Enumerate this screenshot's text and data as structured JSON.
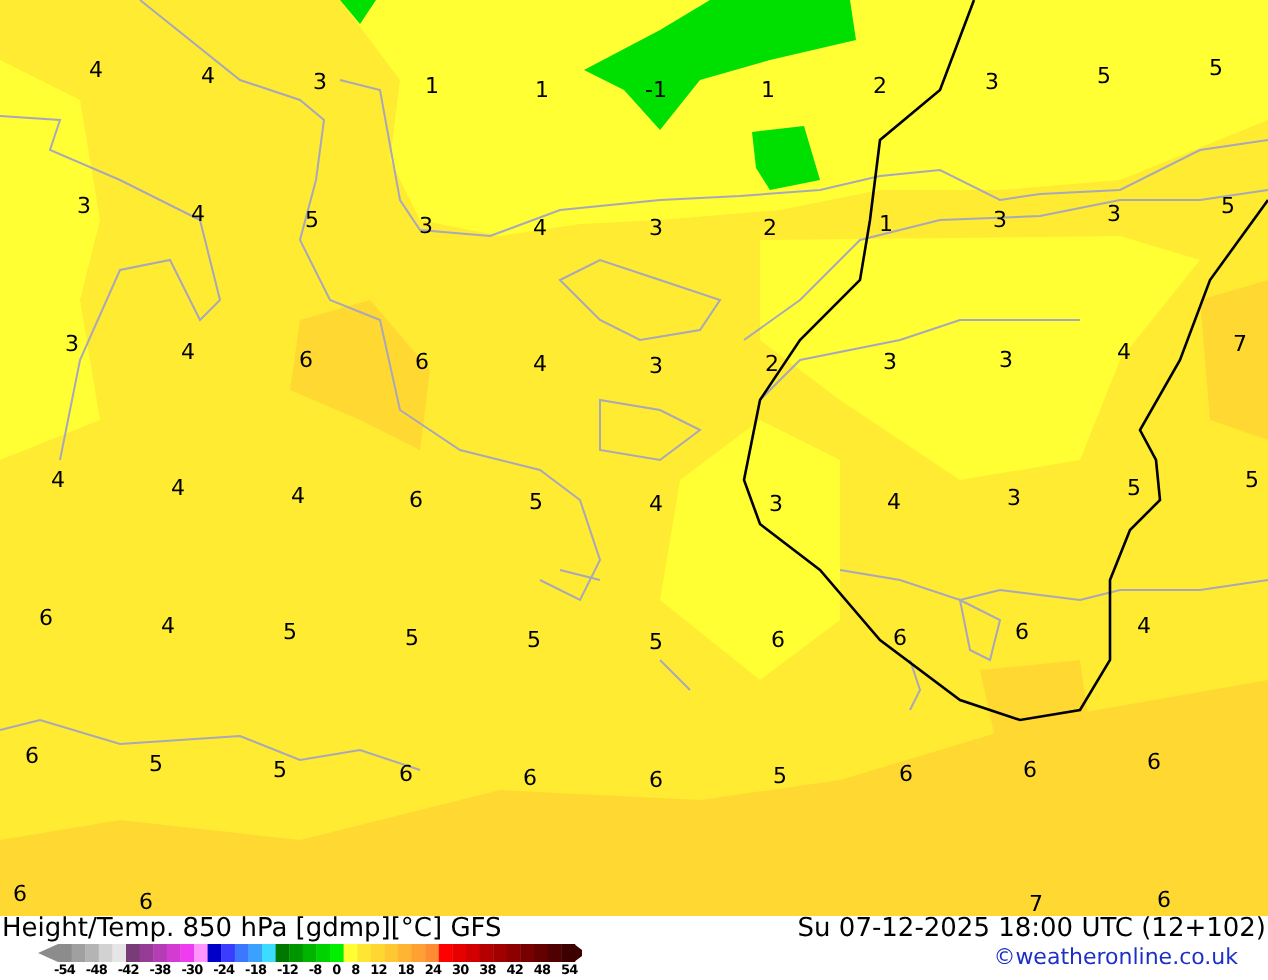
{
  "map": {
    "labels": [
      {
        "text": "4"
      },
      {
        "text": "4"
      },
      {
        "text": "3"
      },
      {
        "text": "1"
      },
      {
        "text": "1"
      },
      {
        "text": "-1"
      },
      {
        "text": "1"
      },
      {
        "text": "2"
      },
      {
        "text": "3"
      },
      {
        "text": "5"
      },
      {
        "text": "5"
      },
      {
        "text": "3"
      },
      {
        "text": "4"
      },
      {
        "text": "5"
      },
      {
        "text": "3"
      },
      {
        "text": "4"
      },
      {
        "text": "3"
      },
      {
        "text": "2"
      },
      {
        "text": "1"
      },
      {
        "text": "3"
      },
      {
        "text": "3"
      },
      {
        "text": "5"
      },
      {
        "text": "3"
      },
      {
        "text": "4"
      },
      {
        "text": "6"
      },
      {
        "text": "6"
      },
      {
        "text": "4"
      },
      {
        "text": "3"
      },
      {
        "text": "2"
      },
      {
        "text": "3"
      },
      {
        "text": "3"
      },
      {
        "text": "4"
      },
      {
        "text": "7"
      },
      {
        "text": "4"
      },
      {
        "text": "4"
      },
      {
        "text": "4"
      },
      {
        "text": "6"
      },
      {
        "text": "5"
      },
      {
        "text": "4"
      },
      {
        "text": "3"
      },
      {
        "text": "4"
      },
      {
        "text": "3"
      },
      {
        "text": "5"
      },
      {
        "text": "5"
      },
      {
        "text": "6"
      },
      {
        "text": "4"
      },
      {
        "text": "5"
      },
      {
        "text": "5"
      },
      {
        "text": "5"
      },
      {
        "text": "5"
      },
      {
        "text": "6"
      },
      {
        "text": "6"
      },
      {
        "text": "6"
      },
      {
        "text": "4"
      },
      {
        "text": "6"
      },
      {
        "text": "5"
      },
      {
        "text": "5"
      },
      {
        "text": "6"
      },
      {
        "text": "6"
      },
      {
        "text": "6"
      },
      {
        "text": "5"
      },
      {
        "text": "6"
      },
      {
        "text": "6"
      },
      {
        "text": "6"
      },
      {
        "text": "6"
      },
      {
        "text": "6"
      },
      {
        "text": "7"
      },
      {
        "text": "6"
      }
    ]
  },
  "footer": {
    "title": "Height/Temp. 850 hPa [gdmp][°C] GFS",
    "valid_time": "Su 07-12-2025 18:00 UTC (12+102)",
    "copyright": "©weatheronline.co.uk",
    "legend": {
      "ticks": [
        "-54",
        "-48",
        "-42",
        "-38",
        "-30",
        "-24",
        "-18",
        "-12",
        "-8",
        "0",
        "8",
        "12",
        "18",
        "24",
        "30",
        "38",
        "42",
        "48",
        "54"
      ]
    }
  }
}
